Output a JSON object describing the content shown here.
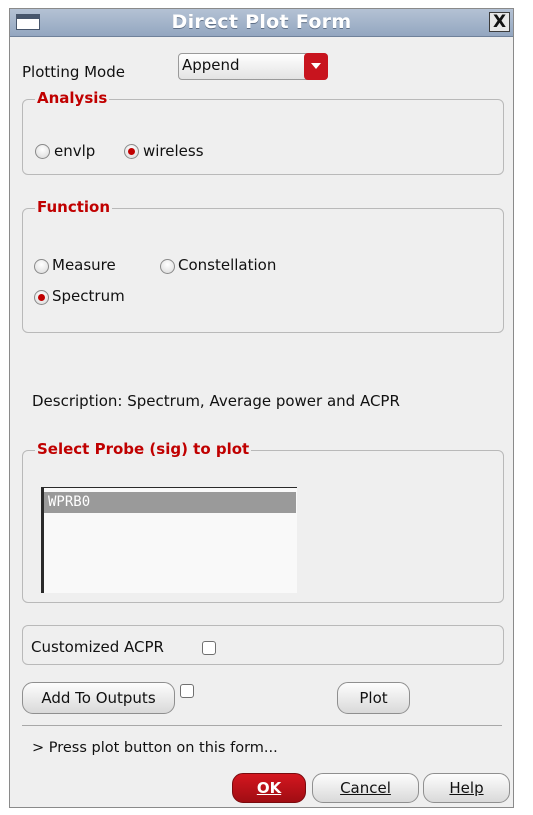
{
  "window": {
    "title": "Direct Plot Form",
    "close_symbol": "X"
  },
  "plotting_mode": {
    "label": "Plotting Mode",
    "selected": "Append"
  },
  "analysis": {
    "title": "Analysis",
    "options": [
      {
        "label": "envlp",
        "selected": false
      },
      {
        "label": "wireless",
        "selected": true
      }
    ]
  },
  "function": {
    "title": "Function",
    "options": [
      {
        "label": "Measure",
        "selected": false
      },
      {
        "label": "Constellation",
        "selected": false
      },
      {
        "label": "Spectrum",
        "selected": true
      }
    ]
  },
  "description": "Description: Spectrum, Average power and ACPR",
  "probe": {
    "title": "Select Probe (sig) to plot",
    "items": [
      "WPRB0"
    ]
  },
  "acpr": {
    "label": "Customized ACPR",
    "checked": false
  },
  "buttons": {
    "add_to_outputs": "Add To Outputs",
    "plot": "Plot",
    "ok": "OK",
    "cancel": "Cancel",
    "help": "Help"
  },
  "add_to_outputs_checked": false,
  "status_text": "> Press plot button on this form...",
  "colors": {
    "accent_red": "#c8141e",
    "group_title": "#c00000",
    "title_bar": "#9aabc4"
  }
}
